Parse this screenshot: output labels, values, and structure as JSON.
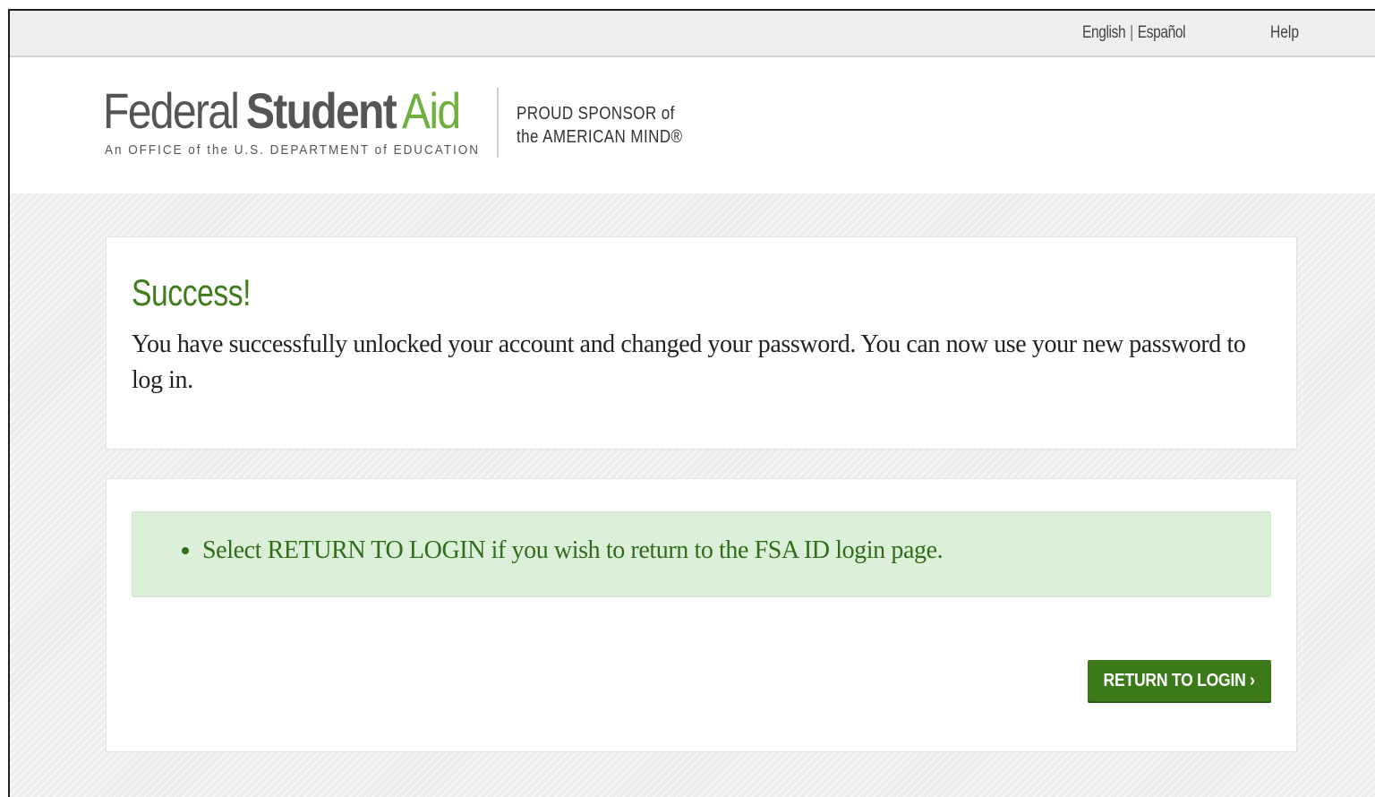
{
  "topbar": {
    "lang_english": "English",
    "lang_separator": "|",
    "lang_spanish": "Español",
    "help": "Help"
  },
  "header": {
    "logo_federal": "Federal",
    "logo_student": "Student",
    "logo_aid": "Aid",
    "logo_tagline": "An OFFICE of the U.S. DEPARTMENT of EDUCATION",
    "sponsor_line1": "PROUD SPONSOR of",
    "sponsor_line2": "the AMERICAN MIND®"
  },
  "success": {
    "title": "Success!",
    "message": "You have successfully unlocked your account and changed your password. You can now use your new password to log in."
  },
  "info": {
    "items": [
      "Select RETURN TO LOGIN if you wish to return to the FSA ID login page."
    ]
  },
  "actions": {
    "return_label": "RETURN TO LOGIN ›"
  },
  "colors": {
    "brand_green": "#6fb03e",
    "success_green": "#3f7d1c",
    "button_green": "#3c7a19",
    "info_bg": "#dcefd9"
  }
}
